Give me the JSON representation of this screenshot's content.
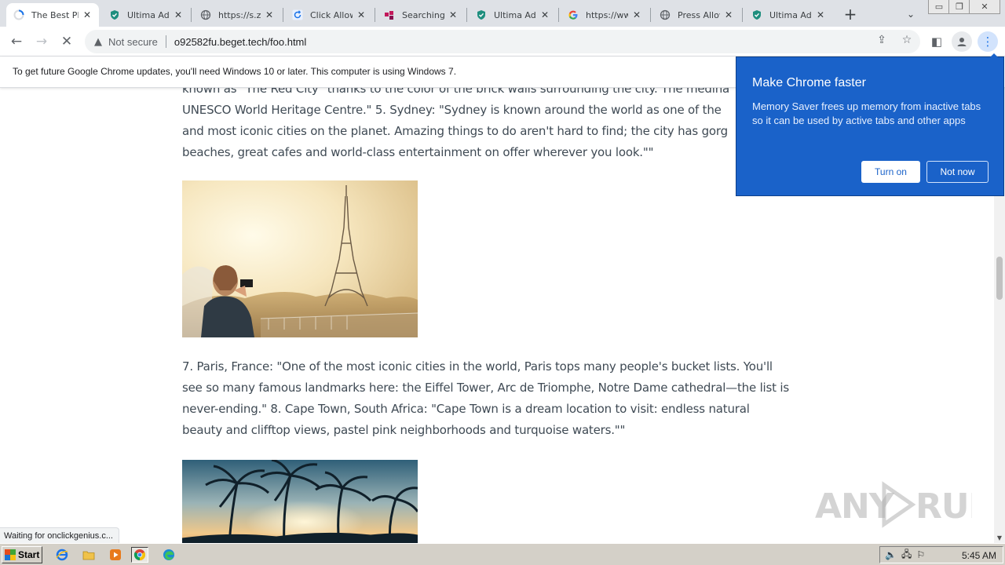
{
  "tabs": [
    {
      "title": "The Best Pl",
      "icon": "loading-spinner-icon",
      "active": true
    },
    {
      "title": "Ultima AdBl",
      "icon": "shield-icon"
    },
    {
      "title": "https://s.zi",
      "icon": "globe-icon"
    },
    {
      "title": "Click Allow",
      "icon": "refresh-icon"
    },
    {
      "title": "Searching f",
      "icon": "colored-squares-icon"
    },
    {
      "title": "Ultima AdBl",
      "icon": "shield-icon"
    },
    {
      "title": "https://ww",
      "icon": "google-icon"
    },
    {
      "title": "Press Allow",
      "icon": "globe-icon"
    },
    {
      "title": "Ultima AdBl",
      "icon": "shield-icon"
    }
  ],
  "toolbar": {
    "not_secure": "Not secure",
    "url": "o92582fu.beget.tech/foo.html"
  },
  "infobar": {
    "text": "To get future Google Chrome updates, you'll need Windows 10 or later. This computer is using Windows 7."
  },
  "content": {
    "paragraph1_lines": [
      "known as \"The Red City\" thanks to the color of the brick walls surrounding the city. The medina",
      "UNESCO World Heritage Centre.\" 5. Sydney: \"Sydney is known around the world as one of the",
      "and most iconic cities on the planet. Amazing things to do aren't hard to find; the city has gorg",
      "beaches, great cafes and world-class entertainment on offer wherever you look.\"\""
    ],
    "paragraph2_lines": [
      "7. Paris, France: \"One of the most iconic cities in the world, Paris tops many people's bucket lists. You'll",
      "see so many famous landmarks here: the Eiffel Tower, Arc de Triomphe, Notre Dame cathedral—the list is",
      "never-ending.\" 8. Cape Town, South Africa: \"Cape Town is a dream location to visit: endless natural",
      "beauty and clifftop views, pastel pink neighborhoods and turquoise waters.\"\""
    ]
  },
  "status_text": "Waiting for onclickgenius.c...",
  "watermark": "ANY RUN",
  "popup": {
    "title": "Make Chrome faster",
    "body": "Memory Saver frees up memory from inactive tabs so it can be used by active tabs and other apps",
    "turn_on": "Turn on",
    "not_now": "Not now"
  },
  "taskbar": {
    "start": "Start",
    "clock": "5:45 AM"
  },
  "colors": {
    "popup_bg": "#1a62c9",
    "tab_strip": "#dee1e6",
    "taskbar": "#d4d0c8"
  }
}
